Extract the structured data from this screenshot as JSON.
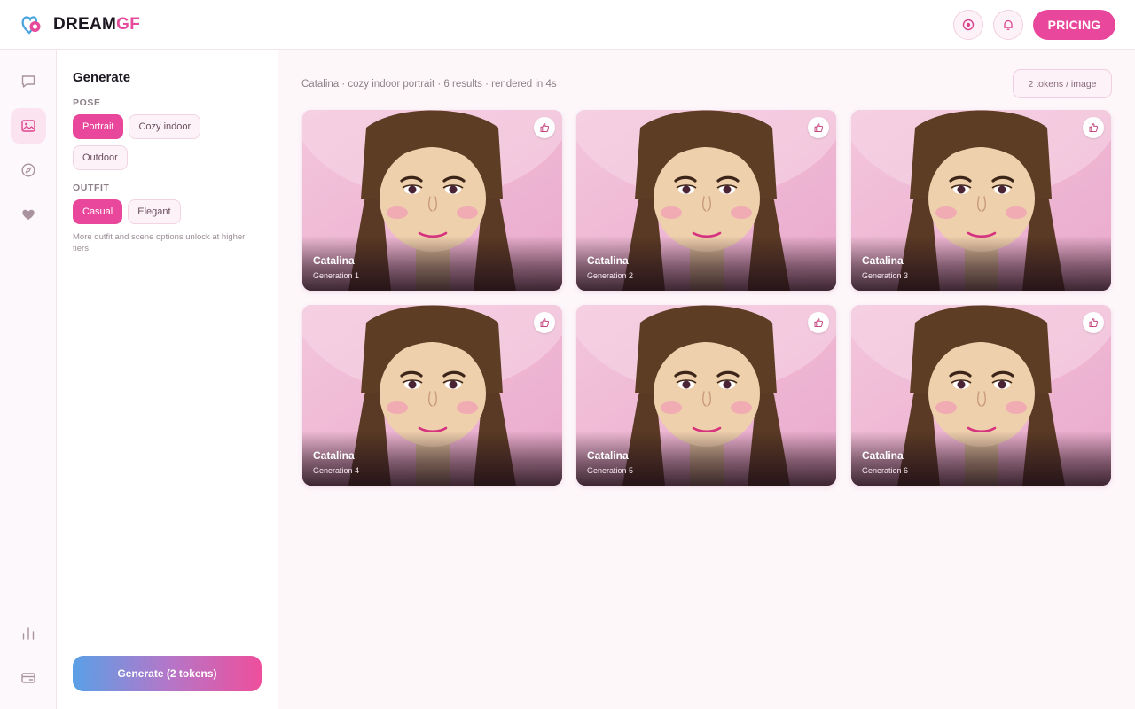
{
  "brand": {
    "name_main": "DREAM",
    "name_accent": "GF",
    "accent_color": "#e64a9b"
  },
  "header": {
    "pricing_label": "PRICING",
    "coin_icon": "coin-icon",
    "bell_icon": "bell-icon"
  },
  "rail": {
    "items": [
      {
        "name": "chat",
        "icon": "chat-icon",
        "active": false
      },
      {
        "name": "gallery",
        "icon": "image-icon",
        "active": true
      },
      {
        "name": "explore",
        "icon": "compass-icon",
        "active": false
      },
      {
        "name": "favorites",
        "icon": "heart-icon",
        "active": false
      },
      {
        "name": "stats",
        "icon": "bar-chart-icon",
        "active": false
      },
      {
        "name": "wallet",
        "icon": "wallet-icon",
        "active": false
      }
    ]
  },
  "panel": {
    "title": "Generate",
    "pose_label": "POSE",
    "pose_options": [
      {
        "label": "Portrait",
        "selected": true
      },
      {
        "label": "Cozy indoor",
        "selected": false
      },
      {
        "label": "Outdoor",
        "selected": false
      }
    ],
    "outfit_label": "OUTFIT",
    "outfit_options": [
      {
        "label": "Casual",
        "selected": true
      },
      {
        "label": "Elegant",
        "selected": false
      }
    ],
    "note": "More outfit and scene options unlock at higher tiers",
    "generate_label": "Generate (2 tokens)"
  },
  "main": {
    "result_meta": "Catalina · cozy indoor portrait · 6 results · rendered in 4s",
    "token_badge": "2 tokens / image",
    "cards": [
      {
        "name": "Catalina",
        "subtitle": "Generation 1"
      },
      {
        "name": "Catalina",
        "subtitle": "Generation 2"
      },
      {
        "name": "Catalina",
        "subtitle": "Generation 3"
      },
      {
        "name": "Catalina",
        "subtitle": "Generation 4"
      },
      {
        "name": "Catalina",
        "subtitle": "Generation 5"
      },
      {
        "name": "Catalina",
        "subtitle": "Generation 6"
      }
    ]
  },
  "colors": {
    "primary": "#e9479b",
    "chip_bg": "#fdf2f7",
    "background": "#fdf7fa"
  }
}
